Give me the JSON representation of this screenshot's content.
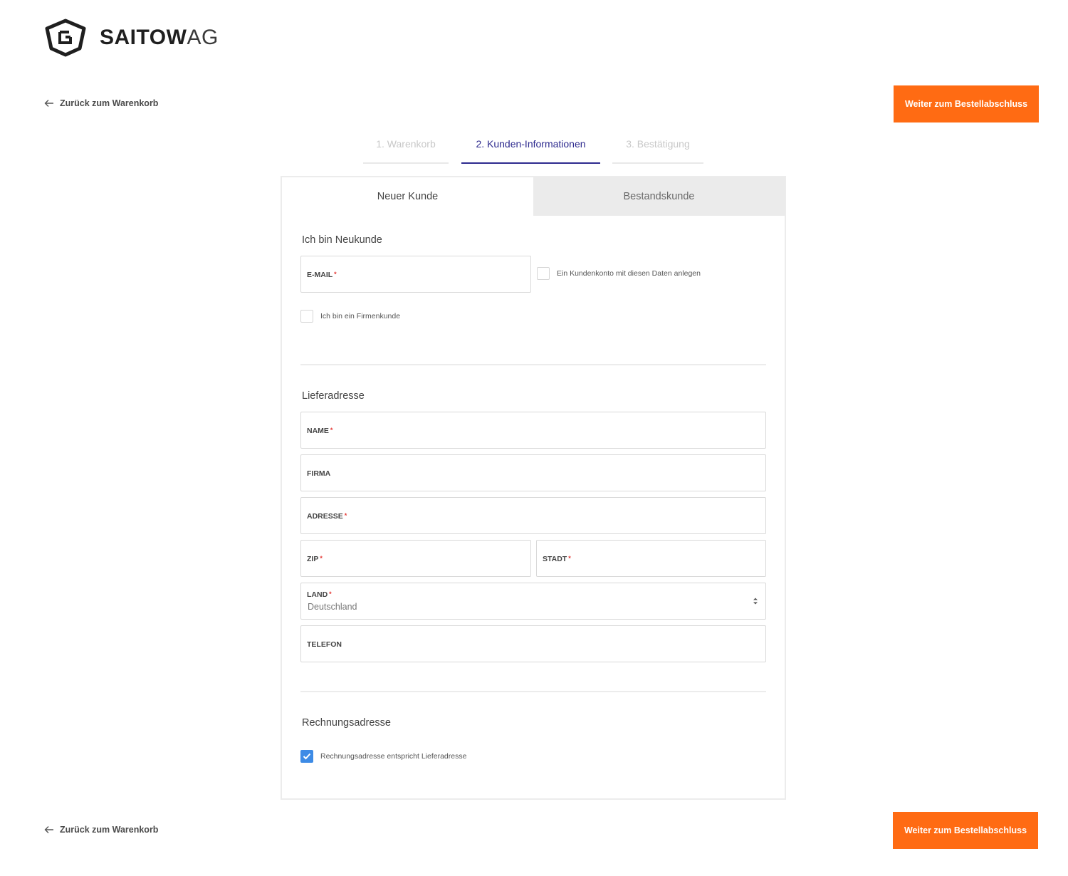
{
  "brand": {
    "logo_icon": "saitow-hexagon-icon",
    "name_bold": "SAITOW",
    "name_light": "AG"
  },
  "nav": {
    "back_label": "Zurück zum Warenkorb",
    "cta_label": "Weiter zum Bestellabschluss"
  },
  "steps": [
    {
      "label": "1. Warenkorb",
      "state": "done"
    },
    {
      "label": "2. Kunden-Informationen",
      "state": "active"
    },
    {
      "label": "3. Bestätigung",
      "state": "upcoming"
    }
  ],
  "tabs": [
    {
      "label": "Neuer Kunde",
      "active": true
    },
    {
      "label": "Bestandskunde",
      "active": false
    }
  ],
  "new_customer": {
    "title": "Ich bin Neukunde",
    "email": {
      "label": "E-MAIL",
      "required": "*",
      "value": ""
    },
    "create_account": {
      "label": "Ein Kundenkonto mit diesen Daten anlegen",
      "checked": false
    },
    "business": {
      "label": "Ich bin ein Firmenkunde",
      "checked": false
    }
  },
  "shipping": {
    "title": "Lieferadresse",
    "name": {
      "label": "NAME",
      "required": "*"
    },
    "company": {
      "label": "FIRMA"
    },
    "address": {
      "label": "ADRESSE",
      "required": "*"
    },
    "zip": {
      "label": "ZIP",
      "required": "*"
    },
    "city": {
      "label": "STADT",
      "required": "*"
    },
    "country": {
      "label": "LAND",
      "required": "*",
      "value": "Deutschland"
    },
    "phone": {
      "label": "TELEFON"
    }
  },
  "billing": {
    "title": "Rechnungsadresse",
    "same_as_shipping": {
      "label": "Rechnungsadresse entspricht Lieferadresse",
      "checked": true
    }
  },
  "colors": {
    "accent": "#ff6b13",
    "active_step": "#2d2a8e",
    "checkbox_checked": "#3d8be6",
    "required": "#e53935"
  }
}
